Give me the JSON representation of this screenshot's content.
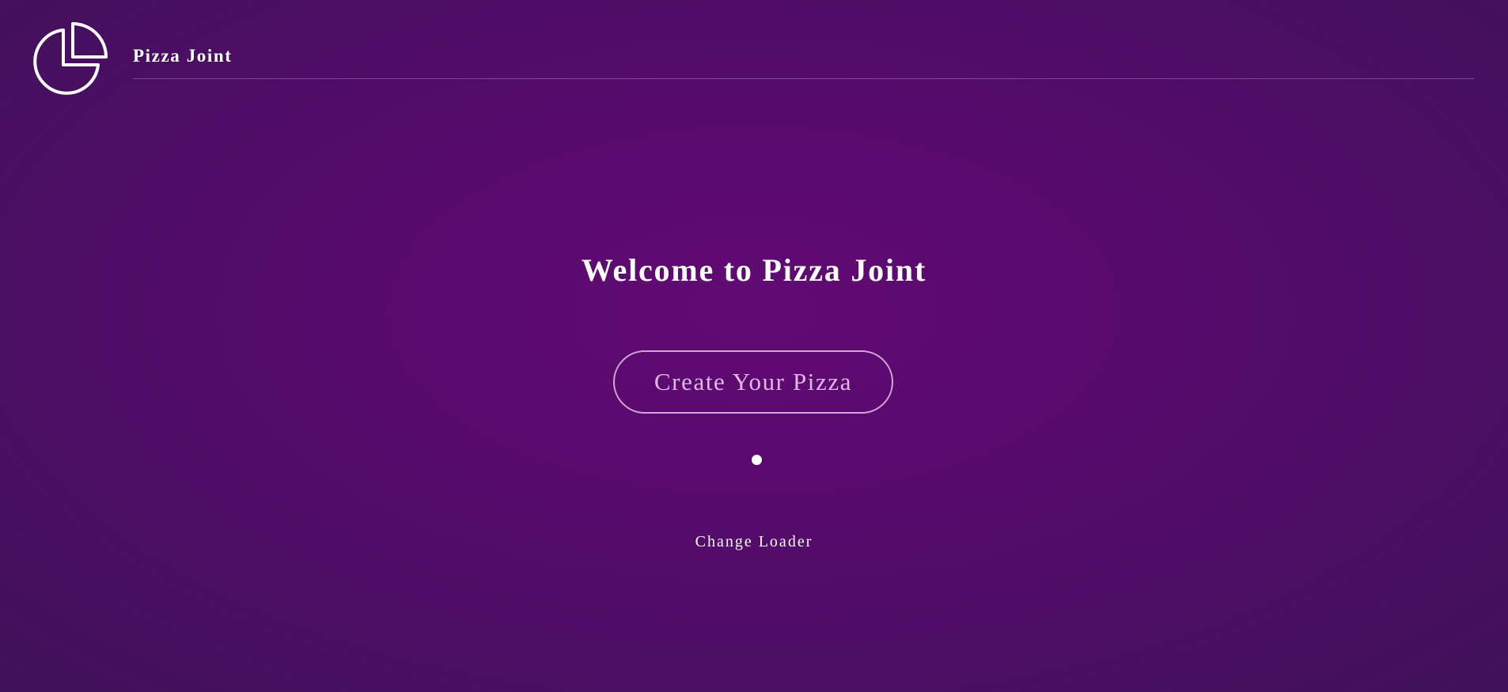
{
  "header": {
    "brand": "Pizza Joint",
    "logo_icon": "pie-chart-icon"
  },
  "main": {
    "welcome_title": "Welcome to Pizza Joint",
    "cta_label": "Create Your Pizza",
    "change_loader_label": "Change Loader"
  },
  "colors": {
    "background_center": "#610a74",
    "background_edge": "#40125a",
    "text": "#ffffff",
    "button_border": "#e1b4e6",
    "button_text": "#e0b8e6"
  }
}
